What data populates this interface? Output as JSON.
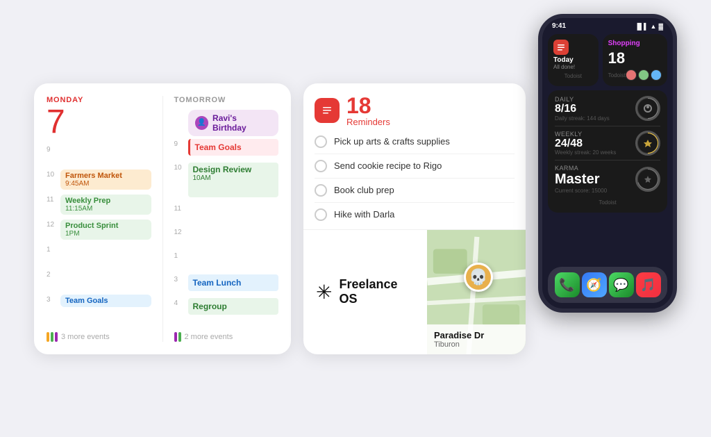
{
  "calendar": {
    "today_label": "MONDAY",
    "today_number": "7",
    "tomorrow_label": "TOMORROW",
    "time_9": "9",
    "time_10": "10",
    "time_11": "11",
    "time_12": "12",
    "time_1": "1",
    "time_2": "2",
    "time_3": "3",
    "time_4": "4",
    "left_events": [
      {
        "time": "10",
        "title": "Farmers Market",
        "sub": "9:45AM",
        "color": "orange"
      },
      {
        "time": "11",
        "title": "Weekly Prep",
        "sub": "11:15AM",
        "color": "green"
      },
      {
        "time": "12",
        "title": "Product Sprint",
        "sub": "1PM",
        "color": "green"
      },
      {
        "time": "3",
        "title": "Team Goals",
        "sub": "",
        "color": "blue"
      }
    ],
    "more_events_left": "3 more events",
    "right_events": [
      {
        "time": "",
        "title": "Ravi's Birthday",
        "type": "birthday"
      },
      {
        "time": "9",
        "title": "Team Goals",
        "type": "red-pill"
      },
      {
        "time": "10",
        "title": "Design Review",
        "sub": "10AM",
        "type": "green-block"
      },
      {
        "time": "3",
        "title": "Team Lunch",
        "type": "blue-pill"
      },
      {
        "time": "4",
        "title": "Regroup",
        "type": "green-pill"
      }
    ],
    "more_events_right": "2 more events"
  },
  "reminders": {
    "count": "18",
    "label": "Reminders",
    "items": [
      "Pick up arts & crafts supplies",
      "Send cookie recipe to Rigo",
      "Book club prep",
      "Hike with Darla"
    ]
  },
  "freelance": {
    "title": "Freelance OS",
    "icon": "✳"
  },
  "map": {
    "location": "Paradise Dr",
    "sublocation": "Tiburon"
  },
  "phone": {
    "time": "9:41",
    "widgets": {
      "today": {
        "title": "Today",
        "sub": "All done!",
        "app": "Todoist"
      },
      "shopping": {
        "title": "Shopping",
        "count": "18",
        "app": "Todoist"
      },
      "daily": {
        "label": "Daily",
        "value": "8/16",
        "sub": "Daily streak: 144 days"
      },
      "weekly": {
        "label": "Weekly",
        "value": "24/48",
        "sub": "Weekly streak: 20 weeks"
      },
      "karma": {
        "label": "Karma",
        "value": "Master",
        "sub": "Current score: 15000"
      },
      "app_label": "Todoist"
    },
    "dock": {
      "phone": "📞",
      "safari": "🧭",
      "messages": "💬",
      "music": "🎵"
    }
  }
}
